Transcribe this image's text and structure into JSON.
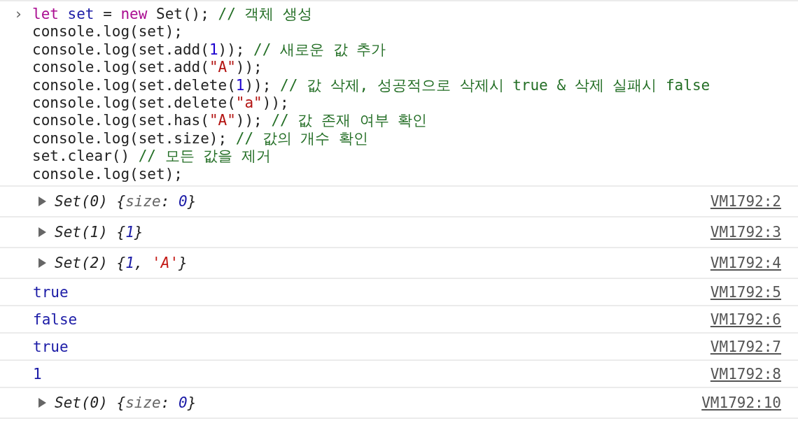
{
  "input": {
    "prompt": "›",
    "lines": [
      [
        {
          "kind": "keyword",
          "text": "let "
        },
        {
          "kind": "variable",
          "text": "set"
        },
        {
          "kind": "plain",
          "text": " = "
        },
        {
          "kind": "keyword",
          "text": "new"
        },
        {
          "kind": "plain",
          "text": " Set(); "
        },
        {
          "kind": "comment",
          "text": "// 객체 생성"
        }
      ],
      [
        {
          "kind": "plain",
          "text": "console.log(set);"
        }
      ],
      [
        {
          "kind": "plain",
          "text": "console.log(set.add("
        },
        {
          "kind": "number",
          "text": "1"
        },
        {
          "kind": "plain",
          "text": ")); "
        },
        {
          "kind": "comment",
          "text": "// 새로운 값 추가"
        }
      ],
      [
        {
          "kind": "plain",
          "text": "console.log(set.add("
        },
        {
          "kind": "string",
          "text": "\"A\""
        },
        {
          "kind": "plain",
          "text": "));"
        }
      ],
      [
        {
          "kind": "plain",
          "text": "console.log(set.delete("
        },
        {
          "kind": "number",
          "text": "1"
        },
        {
          "kind": "plain",
          "text": ")); "
        },
        {
          "kind": "comment",
          "text": "// 값 삭제, 성공적으로 삭제시 true & 삭제 실패시 false"
        }
      ],
      [
        {
          "kind": "plain",
          "text": "console.log(set.delete("
        },
        {
          "kind": "string",
          "text": "\"a\""
        },
        {
          "kind": "plain",
          "text": "));"
        }
      ],
      [
        {
          "kind": "plain",
          "text": "console.log(set.has("
        },
        {
          "kind": "string",
          "text": "\"A\""
        },
        {
          "kind": "plain",
          "text": ")); "
        },
        {
          "kind": "comment",
          "text": "// 값 존재 여부 확인"
        }
      ],
      [
        {
          "kind": "plain",
          "text": "console.log(set.size); "
        },
        {
          "kind": "comment",
          "text": "// 값의 개수 확인"
        }
      ],
      [
        {
          "kind": "plain",
          "text": "set.clear() "
        },
        {
          "kind": "comment",
          "text": "// 모든 값을 제거"
        }
      ],
      [
        {
          "kind": "plain",
          "text": "console.log(set);"
        }
      ]
    ]
  },
  "messages": [
    {
      "kind": "object",
      "expanded": false,
      "tokens": [
        {
          "kind": "plain",
          "text": "Set(0) {"
        },
        {
          "kind": "key",
          "text": "size"
        },
        {
          "kind": "plain",
          "text": ": "
        },
        {
          "kind": "number",
          "text": "0"
        },
        {
          "kind": "plain",
          "text": "}"
        }
      ],
      "source": "VM1792:2"
    },
    {
      "kind": "object",
      "expanded": false,
      "tokens": [
        {
          "kind": "plain",
          "text": "Set(1) {"
        },
        {
          "kind": "number",
          "text": "1"
        },
        {
          "kind": "plain",
          "text": "}"
        }
      ],
      "source": "VM1792:3"
    },
    {
      "kind": "object",
      "expanded": false,
      "tokens": [
        {
          "kind": "plain",
          "text": "Set(2) {"
        },
        {
          "kind": "number",
          "text": "1"
        },
        {
          "kind": "plain",
          "text": ", "
        },
        {
          "kind": "string",
          "text": "'A'"
        },
        {
          "kind": "plain",
          "text": "}"
        }
      ],
      "source": "VM1792:4"
    },
    {
      "kind": "value",
      "text": "true",
      "source": "VM1792:5"
    },
    {
      "kind": "value",
      "text": "false",
      "source": "VM1792:6"
    },
    {
      "kind": "value",
      "text": "true",
      "source": "VM1792:7"
    },
    {
      "kind": "value",
      "text": "1",
      "source": "VM1792:8"
    },
    {
      "kind": "object",
      "expanded": false,
      "tokens": [
        {
          "kind": "plain",
          "text": "Set(0) {"
        },
        {
          "kind": "key",
          "text": "size"
        },
        {
          "kind": "plain",
          "text": ": "
        },
        {
          "kind": "number",
          "text": "0"
        },
        {
          "kind": "plain",
          "text": "}"
        }
      ],
      "source": "VM1792:10"
    }
  ]
}
